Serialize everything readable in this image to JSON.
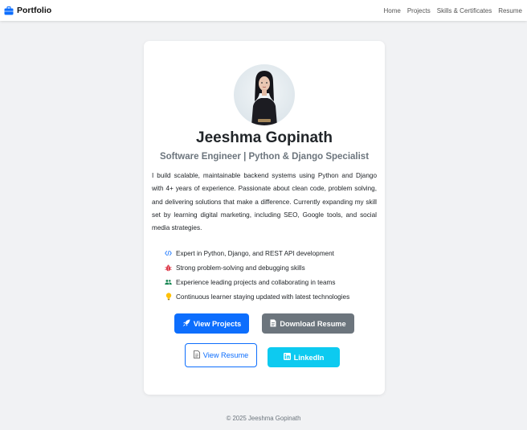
{
  "colors": {
    "primary": "#0d6efd",
    "secondary": "#6c757d",
    "info": "#0dcaf0",
    "page_background": "#f1f2f4"
  },
  "navbar": {
    "brand": "Portfolio",
    "brand_icon": "briefcase-icon",
    "links": [
      "Home",
      "Projects",
      "Skills & Certificates",
      "Resume"
    ]
  },
  "profile": {
    "name": "Jeeshma Gopinath",
    "title": "Software Engineer | Python & Django Specialist",
    "bio": "I build scalable, maintainable backend systems using Python and Django with 4+ years of experience. Passionate about clean code, problem solving, and delivering solutions that make a difference. Currently expanding my skill set by learning digital marketing, including SEO, Google tools, and social media strategies."
  },
  "highlights": [
    {
      "icon": "code-icon",
      "text": "Expert in Python, Django, and REST API development"
    },
    {
      "icon": "bug-icon",
      "text": "Strong problem-solving and debugging skills"
    },
    {
      "icon": "people-icon",
      "text": "Experience leading projects and collaborating in teams"
    },
    {
      "icon": "lightbulb-icon",
      "text": "Continuous learner staying updated with latest technologies"
    }
  ],
  "buttons": {
    "view_projects": "View Projects",
    "download_resume": "Download Resume",
    "view_resume": "View Resume",
    "linkedin": "LinkedIn"
  },
  "footer": "© 2025 Jeeshma Gopinath"
}
